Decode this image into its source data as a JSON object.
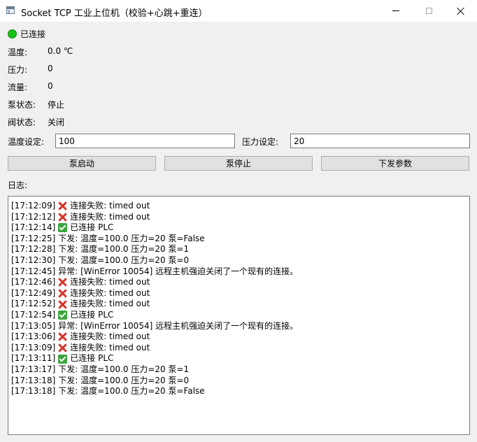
{
  "window": {
    "title": "Socket TCP 工业上位机（校验+心跳+重连）"
  },
  "status": {
    "text": "已连接",
    "color": "#19c319"
  },
  "fields": [
    {
      "label": "温度:",
      "value": "0.0 ℃"
    },
    {
      "label": "压力:",
      "value": "0"
    },
    {
      "label": "流量:",
      "value": "0"
    },
    {
      "label": "泵状态:",
      "value": "停止"
    },
    {
      "label": "阀状态:",
      "value": "关闭"
    }
  ],
  "inputs": {
    "temp_label": "温度设定:",
    "temp_value": "100",
    "pressure_label": "压力设定:",
    "pressure_value": "20"
  },
  "buttons": {
    "pump_start": "泵启动",
    "pump_stop": "泵停止",
    "send_params": "下发参数"
  },
  "log": {
    "label": "日志:",
    "lines": [
      {
        "time": "[17:12:09]",
        "icon": "fail",
        "text": "连接失败: timed out"
      },
      {
        "time": "[17:12:12]",
        "icon": "fail",
        "text": "连接失败: timed out"
      },
      {
        "time": "[17:12:14]",
        "icon": "ok",
        "text": "已连接 PLC"
      },
      {
        "time": "[17:12:25]",
        "icon": "",
        "text": "下发: 温度=100.0 压力=20 泵=False"
      },
      {
        "time": "[17:12:28]",
        "icon": "",
        "text": "下发: 温度=100.0 压力=20 泵=1"
      },
      {
        "time": "[17:12:30]",
        "icon": "",
        "text": "下发: 温度=100.0 压力=20 泵=0"
      },
      {
        "time": "[17:12:45]",
        "icon": "",
        "text": "异常: [WinError 10054] 远程主机强迫关闭了一个现有的连接。"
      },
      {
        "time": "[17:12:46]",
        "icon": "fail",
        "text": "连接失败: timed out"
      },
      {
        "time": "[17:12:49]",
        "icon": "fail",
        "text": "连接失败: timed out"
      },
      {
        "time": "[17:12:52]",
        "icon": "fail",
        "text": "连接失败: timed out"
      },
      {
        "time": "[17:12:54]",
        "icon": "ok",
        "text": "已连接 PLC"
      },
      {
        "time": "[17:13:05]",
        "icon": "",
        "text": "异常: [WinError 10054] 远程主机强迫关闭了一个现有的连接。"
      },
      {
        "time": "[17:13:06]",
        "icon": "fail",
        "text": "连接失败: timed out"
      },
      {
        "time": "[17:13:09]",
        "icon": "fail",
        "text": "连接失败: timed out"
      },
      {
        "time": "[17:13:11]",
        "icon": "ok",
        "text": "已连接 PLC"
      },
      {
        "time": "[17:13:17]",
        "icon": "",
        "text": "下发: 温度=100.0 压力=20 泵=1"
      },
      {
        "time": "[17:13:18]",
        "icon": "",
        "text": "下发: 温度=100.0 压力=20 泵=0"
      },
      {
        "time": "[17:13:18]",
        "icon": "",
        "text": "下发: 温度=100.0 压力=20 泵=False"
      }
    ]
  }
}
